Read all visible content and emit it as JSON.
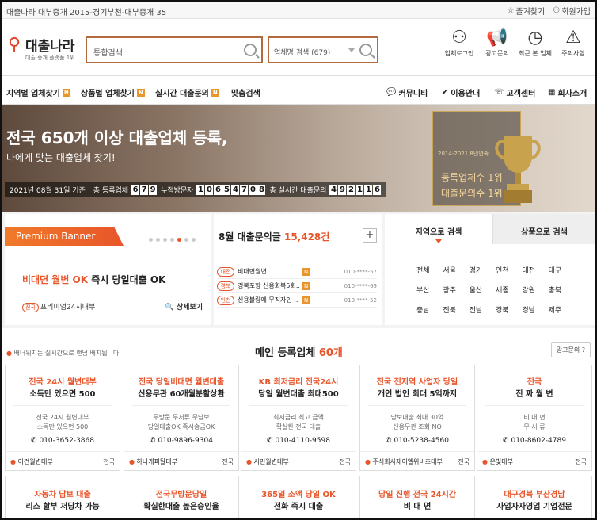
{
  "topbar": {
    "left_text": "대출나라 대부중개 2015-경기부천-대부중개 35",
    "bookmark": "즐겨찾기",
    "signup": "회원가입"
  },
  "logo": {
    "name": "대출나라",
    "tagline": "대출 중개 플랫폼 1위"
  },
  "search": {
    "main_placeholder": "통합검색",
    "company_placeholder": "업체명 검색 (679)"
  },
  "header_icons": [
    {
      "label": "업체로그인",
      "icon": "user-icon"
    },
    {
      "label": "광고문의",
      "icon": "megaphone-icon"
    },
    {
      "label": "최근 본 업체",
      "icon": "clock-icon"
    },
    {
      "label": "주의사항",
      "icon": "warning-icon"
    }
  ],
  "nav": {
    "left": [
      "지역별 업체찾기",
      "상품별 업체찾기",
      "실시간 대출문의",
      "맞춤검색"
    ],
    "badge": "N",
    "right": [
      "커뮤니티",
      "이용안내",
      "고객센터",
      "회사소개"
    ]
  },
  "hero": {
    "headline_prefix": "전국",
    "headline_bold": "650개 이상",
    "headline_suffix": "대출업체 등록,",
    "subline": "나에게 맞는 대출업체 찾기!",
    "date": "2021년 08월 31일 기준",
    "stat1_label": "총 등록업체",
    "stat1_digits": [
      "6",
      "7",
      "9"
    ],
    "stat2_label": "누적방문자",
    "stat2_digits": [
      "1",
      "0",
      "6",
      "5",
      "4",
      "7",
      "0",
      "8"
    ],
    "stat3_label": "총 실시간 대출문의",
    "stat3_digits": [
      "4",
      "9",
      "2",
      "1",
      "1",
      "6"
    ],
    "award_years": "2014-2021 8년연속",
    "award_line1": "등록업체수 1위",
    "award_line2": "대출문의수 1위"
  },
  "premium": {
    "banner": "Premium Banner",
    "title_highlight": "비대면 월변 OK",
    "title_rest": "즉시 당일대출 OK",
    "region_tag": "전국",
    "company": "프리미엄24시대부",
    "detail": "상세보기"
  },
  "news": {
    "title_prefix": "8월 대출문의글",
    "count": "15,428건",
    "rows": [
      {
        "tag": "대전",
        "title": "비대면월변",
        "num": "010-****-57"
      },
      {
        "tag": "경북",
        "title": "경북포항 신용회복5회..",
        "num": "010-****-69"
      },
      {
        "tag": "인천",
        "title": "신용불량에 무직자인 ..",
        "num": "010-****-52"
      }
    ]
  },
  "region_search": {
    "tab1": "지역으로 검색",
    "tab2": "상품으로 검색",
    "regions": [
      "전체",
      "서울",
      "경기",
      "인천",
      "대전",
      "대구",
      "부산",
      "광주",
      "울산",
      "세종",
      "강원",
      "충북",
      "충남",
      "전북",
      "전남",
      "경북",
      "경남",
      "제주"
    ]
  },
  "list": {
    "note": "배너위치는 실시간으로 랜덤 배치됩니다.",
    "title_prefix": "메인 등록업체",
    "title_count": "60개",
    "ad_button": "광고문의"
  },
  "cards": [
    {
      "t1": "전국 24시 월변대부",
      "t2": "소득만 있으면 500",
      "d1": "전국 24시 월변대부",
      "d2": "소득만 있으면 500",
      "phone": "010-3652-3868",
      "name": "이건월변대부",
      "region": "전국"
    },
    {
      "t1": "전국 당일비대면 월변대출",
      "t2": "신용무관 60개월분할상환",
      "d1": "무방문 무서류 무담보",
      "d2": "당일대출OK 즉시송금OK",
      "phone": "010-9896-9304",
      "name": "하나캐피탈대부",
      "region": "전국"
    },
    {
      "t1": "KB 최저금리 전국24시",
      "t2": "당일 월변대출 최대500",
      "d1": "최저금리 최고 금액",
      "d2": "확실한 전국 대출",
      "phone": "010-4110-9598",
      "name": "서민월변대부",
      "region": "전국"
    },
    {
      "t1": "전국 전지역 사업자 당일",
      "t2": "개인 법인 최대 5억까지",
      "d1": "담보대출 최대 30억",
      "d2": "신용무관 조회 NO",
      "phone": "010-5238-4560",
      "name": "주식회사제이엘위비즈대부",
      "region": "전국"
    },
    {
      "t1": "전국",
      "t2": "진 짜 월 변",
      "d1": "비 대 면",
      "d2": "무 서 류",
      "phone": "010-8602-4789",
      "name": "은빛대부",
      "region": "전국"
    }
  ],
  "cards_row2": [
    {
      "t1": "자동차 담보 대출",
      "t2": "리스 할부 저당차 가능"
    },
    {
      "t1": "전국무방문당일",
      "t2": "확실한대출 높은승인율"
    },
    {
      "t1": "365일 소액 당일 OK",
      "t2": "전화 즉시 대출"
    },
    {
      "t1": "당일 진행 전국 24시간",
      "t2": "비 대 면"
    },
    {
      "t1": "대구경북 부산경남",
      "t2": "사업자자영업 기업전문"
    }
  ]
}
